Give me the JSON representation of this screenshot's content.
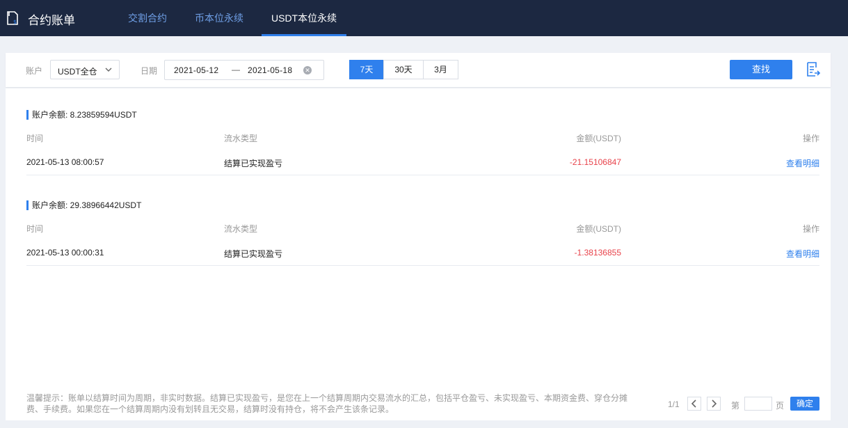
{
  "header": {
    "title": "合约账单",
    "tabs": [
      {
        "label": "交割合约"
      },
      {
        "label": "币本位永续"
      },
      {
        "label": "USDT本位永续"
      }
    ]
  },
  "filters": {
    "account_label": "账户",
    "account_value": "USDT全仓",
    "date_label": "日期",
    "date_start": "2021-05-12",
    "date_sep": "—",
    "date_end": "2021-05-18",
    "ranges": [
      {
        "label": "7天"
      },
      {
        "label": "30天"
      },
      {
        "label": "3月"
      }
    ],
    "search_label": "查找"
  },
  "columns": {
    "time": "时间",
    "type": "流水类型",
    "amount": "金额(USDT)",
    "action": "操作"
  },
  "sections": [
    {
      "balance": "账户余额: 8.23859594USDT",
      "rows": [
        {
          "time": "2021-05-13 08:00:57",
          "type": "结算已实现盈亏",
          "amount": "-21.15106847",
          "action": "查看明细"
        }
      ]
    },
    {
      "balance": "账户余额: 29.38966442USDT",
      "rows": [
        {
          "time": "2021-05-13 00:00:31",
          "type": "结算已实现盈亏",
          "amount": "-1.38136855",
          "action": "查看明细"
        }
      ]
    }
  ],
  "footer": {
    "note": "温馨提示：账单以结算时间为周期，非实时数据。结算已实现盈亏，是您在上一个结算周期内交易流水的汇总，包括平仓盈亏、未实现盈亏、本期资金费、穿仓分摊费、手续费。如果您在一个结算周期内没有划转且无交易，结算时没有持仓，将不会产生该条记录。",
    "page_info": "1/1",
    "page_prefix": "第",
    "page_suffix": "页",
    "confirm_label": "确定"
  },
  "colors": {
    "header_bg": "#1c2841",
    "accent": "#2f80ed",
    "negative": "#e8434b"
  }
}
